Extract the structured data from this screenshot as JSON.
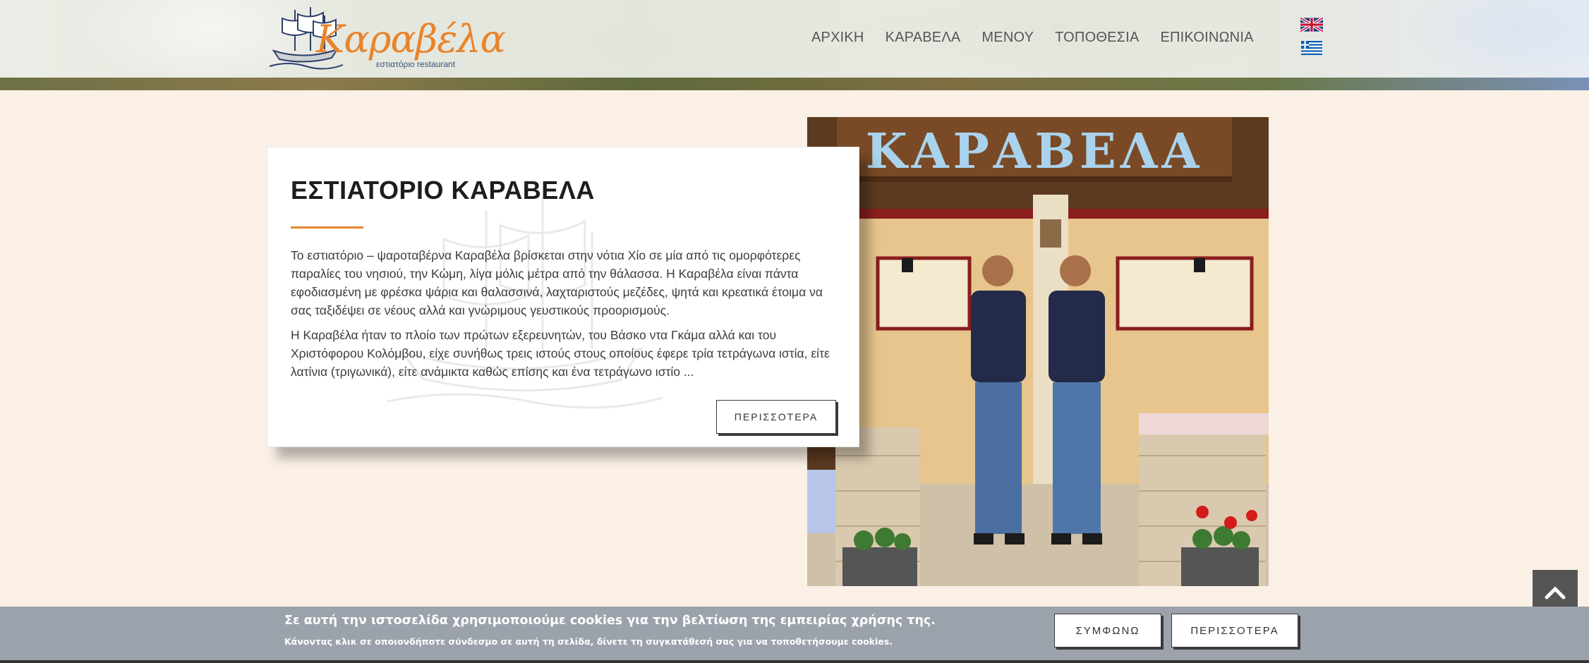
{
  "header": {
    "logo": {
      "name": "Καραβέλα",
      "subtitle": "εστιατόριο restaurant"
    },
    "nav": [
      {
        "label": "ΑΡΧΙΚΗ"
      },
      {
        "label": "ΚΑΡΑΒΕΛΑ"
      },
      {
        "label": "ΜΕΝΟΥ"
      },
      {
        "label": "ΤΟΠΟΘΕΣΙΑ"
      },
      {
        "label": "ΕΠΙΚΟΙΝΩΝΙΑ"
      }
    ],
    "languages": [
      {
        "icon": "uk-flag-icon"
      },
      {
        "icon": "greek-flag-icon"
      }
    ]
  },
  "intro": {
    "title": "ΕΣΤΙΑΤΟΡΙΟ ΚΑΡΑΒΕΛΑ",
    "paragraph1": "Το εστιατόριο – ψαροταβέρνα Καραβέλα βρίσκεται στην νότια Χίο σε μία από τις ομορφότερες παραλίες του νησιού, την Κώμη, λίγα μόλις μέτρα από την θάλασσα. Η Καραβέλα είναι πάντα εφοδιασμένη με φρέσκα ψάρια και θαλασσινά, λαχταριστούς μεζέδες, ψητά και κρεατικά έτοιμα να σας ταξιδέψει σε νέους αλλά και γνώριμους γευστικούς προορισμούς.",
    "paragraph2": "Η Καραβέλα  ήταν το πλοίο των πρώτων εξερευνητών, του  Βάσκο ντα Γκάμα αλλά και του Χριστόφορου Κολόμβου, είχε συνήθως τρεις ιστούς στους οποίους έφερε τρία τετράγωνα ιστία, είτε λατίνια (τριγωνικά), είτε ανάμικτα καθώς επίσης και ένα τετράγωνο ιστίο ...",
    "more_label": "ΠΕΡΙΣΣΟΤΕΡΑ"
  },
  "photo": {
    "sign_text": "ΚΑΡΑΒΕΛΑ"
  },
  "scroll_top": {
    "icon": "chevron-up-icon"
  },
  "cookie_bar": {
    "title": "Σε αυτή την ιστοσελίδα χρησιμοποιούμε cookies για την βελτίωση της εμπειρίας χρήσης της.",
    "subtitle": "Κάνοντας κλικ σε οποιονδήποτε σύνδεσμο σε αυτή τη σελίδα, δίνετε τη συγκατάθεσή σας για να τοποθετήσουμε cookies.",
    "agree_label": "ΣΥΜΦΩΝΩ",
    "more_label": "ΠΕΡΙΣΣΟΤΕΡΑ"
  },
  "colors": {
    "accent": "#e8842c",
    "background": "#fbf0e6",
    "cookie_bar": "#9ba2ab",
    "logo_navy": "#3a4f7a"
  }
}
